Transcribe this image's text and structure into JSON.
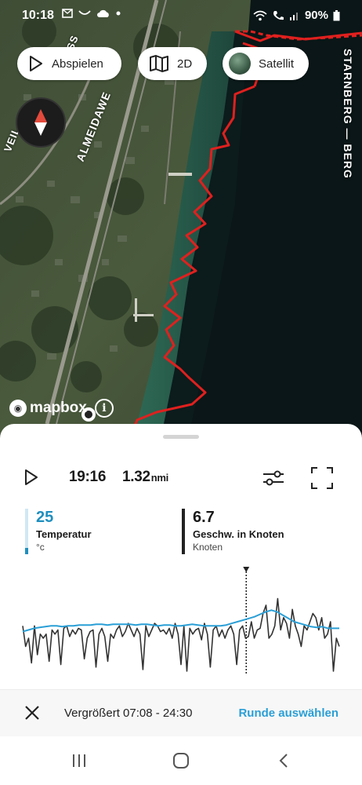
{
  "status_bar": {
    "time": "10:18",
    "battery": "90%"
  },
  "map": {
    "play_label": "Abspielen",
    "view_label": "2D",
    "layer_label": "Satellit",
    "street_labels": [
      "STARNBERG — BERG",
      "ALMEIDAWE",
      "ASS",
      "VEIL"
    ],
    "attribution": "mapbox",
    "track_color": "#e0201e"
  },
  "playback": {
    "time": "19:16",
    "distance": "1.32",
    "distance_unit": "nmi"
  },
  "metrics": [
    {
      "value": "25",
      "name": "Temperatur",
      "unit": "°c",
      "color": "#1f8fbe"
    },
    {
      "value": "6.7",
      "name": "Geschw. in Knoten",
      "unit": "Knoten",
      "color": "#222222"
    }
  ],
  "chart_data": {
    "type": "line",
    "series": [
      {
        "name": "Temperatur",
        "color": "#2a9fd6",
        "values": [
          52,
          50,
          48,
          47,
          46,
          45,
          45,
          46,
          45,
          45,
          44,
          44,
          44,
          43,
          43,
          44,
          43,
          43,
          43,
          43,
          44,
          43,
          43,
          44,
          45,
          44,
          44,
          45,
          45,
          44,
          43,
          44,
          45,
          45,
          45,
          45,
          44,
          42,
          40,
          38,
          36,
          34,
          31,
          28,
          26,
          28,
          32,
          36,
          40,
          42,
          44,
          46,
          47,
          46,
          48,
          48,
          48
        ]
      },
      {
        "name": "Geschw. in Knoten",
        "color": "#333333",
        "values": [
          45,
          70,
          60,
          90,
          45,
          80,
          55,
          60,
          55,
          88,
          50,
          55,
          50,
          92,
          48,
          45,
          58,
          50,
          55,
          48,
          50,
          85,
          60,
          52,
          50,
          95,
          55,
          48,
          58,
          88,
          55,
          60,
          50,
          45,
          58,
          52,
          42,
          50,
          58,
          48,
          55,
          98,
          45,
          58,
          50,
          42,
          45,
          52,
          50,
          55,
          48,
          60,
          42,
          55,
          92,
          45,
          100,
          48,
          55,
          50,
          48,
          62,
          42,
          55,
          95,
          50,
          45,
          58,
          50,
          60,
          50,
          45,
          55,
          92,
          50,
          45,
          60,
          58,
          40,
          60,
          50,
          48,
          30,
          20,
          60,
          55,
          45,
          12,
          50,
          35,
          42,
          60,
          25,
          45,
          55,
          70,
          45,
          50,
          40,
          30,
          35,
          50,
          35,
          60,
          55,
          40,
          100,
          60,
          70
        ]
      }
    ],
    "cursor_fraction": 0.705
  },
  "zoom_bar": {
    "zoom_text": "Vergrößert 07:08 - 24:30",
    "lap_link": "Runde auswählen"
  }
}
